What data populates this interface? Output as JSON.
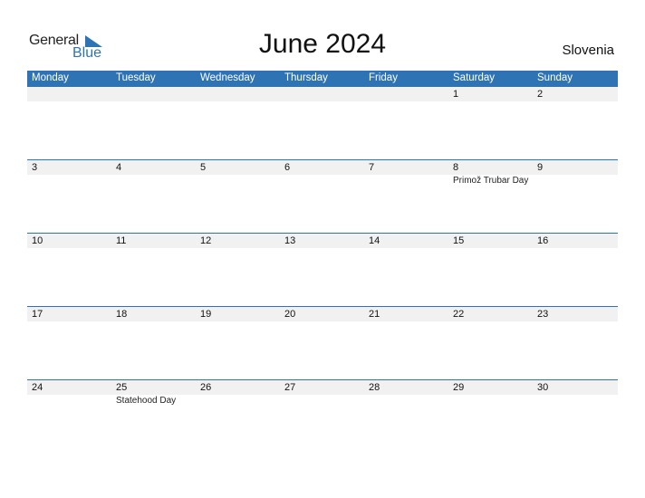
{
  "logo": {
    "line1": "General",
    "line2": "Blue"
  },
  "title": "June 2024",
  "country": "Slovenia",
  "colors": {
    "accent": "#2e74b5",
    "band": "#f1f1f1"
  },
  "weekdays": [
    "Monday",
    "Tuesday",
    "Wednesday",
    "Thursday",
    "Friday",
    "Saturday",
    "Sunday"
  ],
  "weeks": [
    [
      {
        "day": ""
      },
      {
        "day": ""
      },
      {
        "day": ""
      },
      {
        "day": ""
      },
      {
        "day": ""
      },
      {
        "day": "1"
      },
      {
        "day": "2"
      }
    ],
    [
      {
        "day": "3"
      },
      {
        "day": "4"
      },
      {
        "day": "5"
      },
      {
        "day": "6"
      },
      {
        "day": "7"
      },
      {
        "day": "8",
        "holiday": "Primož Trubar Day"
      },
      {
        "day": "9"
      }
    ],
    [
      {
        "day": "10"
      },
      {
        "day": "11"
      },
      {
        "day": "12"
      },
      {
        "day": "13"
      },
      {
        "day": "14"
      },
      {
        "day": "15"
      },
      {
        "day": "16"
      }
    ],
    [
      {
        "day": "17"
      },
      {
        "day": "18"
      },
      {
        "day": "19"
      },
      {
        "day": "20"
      },
      {
        "day": "21"
      },
      {
        "day": "22"
      },
      {
        "day": "23"
      }
    ],
    [
      {
        "day": "24"
      },
      {
        "day": "25",
        "holiday": "Statehood Day"
      },
      {
        "day": "26"
      },
      {
        "day": "27"
      },
      {
        "day": "28"
      },
      {
        "day": "29"
      },
      {
        "day": "30"
      }
    ]
  ]
}
